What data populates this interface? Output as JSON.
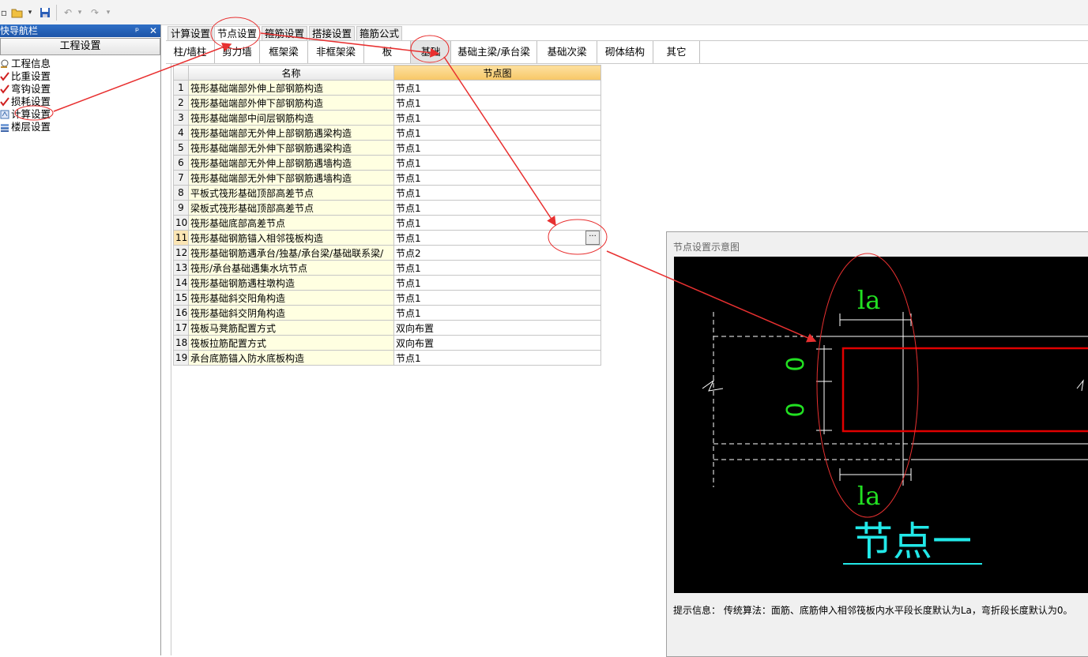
{
  "nav": {
    "title": "快导航栏",
    "pin": "ᵖ",
    "close": "✕",
    "header": "工程设置",
    "items": [
      {
        "label": "工程信息",
        "icon": "magnifier-icon"
      },
      {
        "label": "比重设置",
        "icon": "check-icon"
      },
      {
        "label": "弯钩设置",
        "icon": "check-icon"
      },
      {
        "label": "损耗设置",
        "icon": "check-icon"
      },
      {
        "label": "计算设置",
        "icon": "calc-icon"
      },
      {
        "label": "楼层设置",
        "icon": "layers-icon"
      }
    ]
  },
  "tabs": [
    "计算设置",
    "节点设置",
    "箍筋设置",
    "搭接设置",
    "箍筋公式"
  ],
  "active_tab": "节点设置",
  "categories": [
    "柱/墙柱",
    "剪力墙",
    "框架梁",
    "非框架梁",
    "板",
    "基础",
    "基础主梁/承台梁",
    "基础次梁",
    "砌体结构",
    "其它"
  ],
  "active_category": "基础",
  "grid": {
    "headers": [
      "名称",
      "节点图"
    ],
    "selected_row": "11",
    "rows": [
      {
        "num": "1",
        "name": "筏形基础端部外伸上部钢筋构造",
        "value": "节点1"
      },
      {
        "num": "2",
        "name": "筏形基础端部外伸下部钢筋构造",
        "value": "节点1"
      },
      {
        "num": "3",
        "name": "筏形基础端部中间层钢筋构造",
        "value": "节点1"
      },
      {
        "num": "4",
        "name": "筏形基础端部无外伸上部钢筋遇梁构造",
        "value": "节点1"
      },
      {
        "num": "5",
        "name": "筏形基础端部无外伸下部钢筋遇梁构造",
        "value": "节点1"
      },
      {
        "num": "6",
        "name": "筏形基础端部无外伸上部钢筋遇墙构造",
        "value": "节点1"
      },
      {
        "num": "7",
        "name": "筏形基础端部无外伸下部钢筋遇墙构造",
        "value": "节点1"
      },
      {
        "num": "8",
        "name": "平板式筏形基础顶部高差节点",
        "value": "节点1"
      },
      {
        "num": "9",
        "name": "梁板式筏形基础顶部高差节点",
        "value": "节点1"
      },
      {
        "num": "10",
        "name": "筏形基础底部高差节点",
        "value": "节点1"
      },
      {
        "num": "11",
        "name": "筏形基础钢筋锚入相邻筏板构造",
        "value": "节点1"
      },
      {
        "num": "12",
        "name": "筏形基础钢筋遇承台/独基/承台梁/基础联系梁/",
        "value": "节点2"
      },
      {
        "num": "13",
        "name": "筏形/承台基础遇集水坑节点",
        "value": "节点1"
      },
      {
        "num": "14",
        "name": "筏形基础钢筋遇柱墩构造",
        "value": "节点1"
      },
      {
        "num": "15",
        "name": "筏形基础斜交阳角构造",
        "value": "节点1"
      },
      {
        "num": "16",
        "name": "筏形基础斜交阴角构造",
        "value": "节点1"
      },
      {
        "num": "17",
        "name": "筏板马凳筋配置方式",
        "value": "双向布置"
      },
      {
        "num": "18",
        "name": "筏板拉筋配置方式",
        "value": "双向布置"
      },
      {
        "num": "19",
        "name": "承台底筋锚入防水底板构造",
        "value": "节点1"
      }
    ],
    "ellipsis": "···"
  },
  "diagram": {
    "title": "节点设置示意图",
    "label_top": "la",
    "label_bottom": "la",
    "label_zero_1": "0",
    "label_zero_2": "0",
    "node_caption": "节点一",
    "hint": "提示信息： 传统算法：面筋、底筋伸入相邻筏板内水平段长度默认为La，弯折段长度默认为0。"
  },
  "colors": {
    "label_green": "#22e022",
    "caption_cyan": "#22e8e8",
    "rebar_red": "#e00000",
    "annotation_red": "#e83030"
  }
}
